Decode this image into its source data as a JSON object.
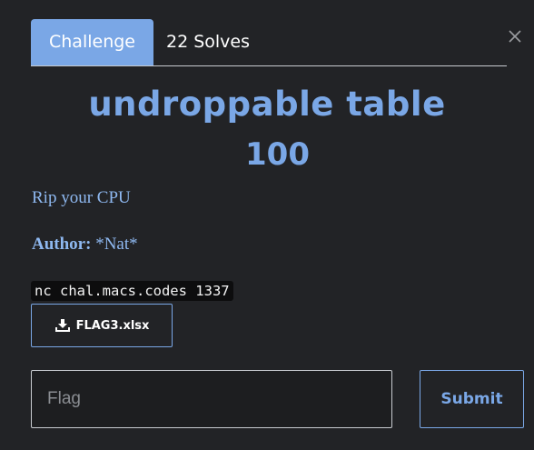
{
  "tabs": [
    {
      "label": "Challenge",
      "active": true
    },
    {
      "label": "22 Solves",
      "active": false
    }
  ],
  "challenge": {
    "name": "undroppable table",
    "value": "100",
    "description": "Rip your CPU",
    "author_label": "Author:",
    "author_value": "*Nat*",
    "connection": "nc chal.macs.codes 1337"
  },
  "files": [
    {
      "name": "FLAG3.xlsx",
      "icon": "download-icon"
    }
  ],
  "submission": {
    "placeholder": "Flag",
    "value": "",
    "submit_label": "Submit"
  },
  "colors": {
    "background": "#222326",
    "accent": "#7aa7e6",
    "text_link": "#8eb8f0"
  },
  "icons": {
    "close": "close-icon",
    "download": "download-icon"
  }
}
